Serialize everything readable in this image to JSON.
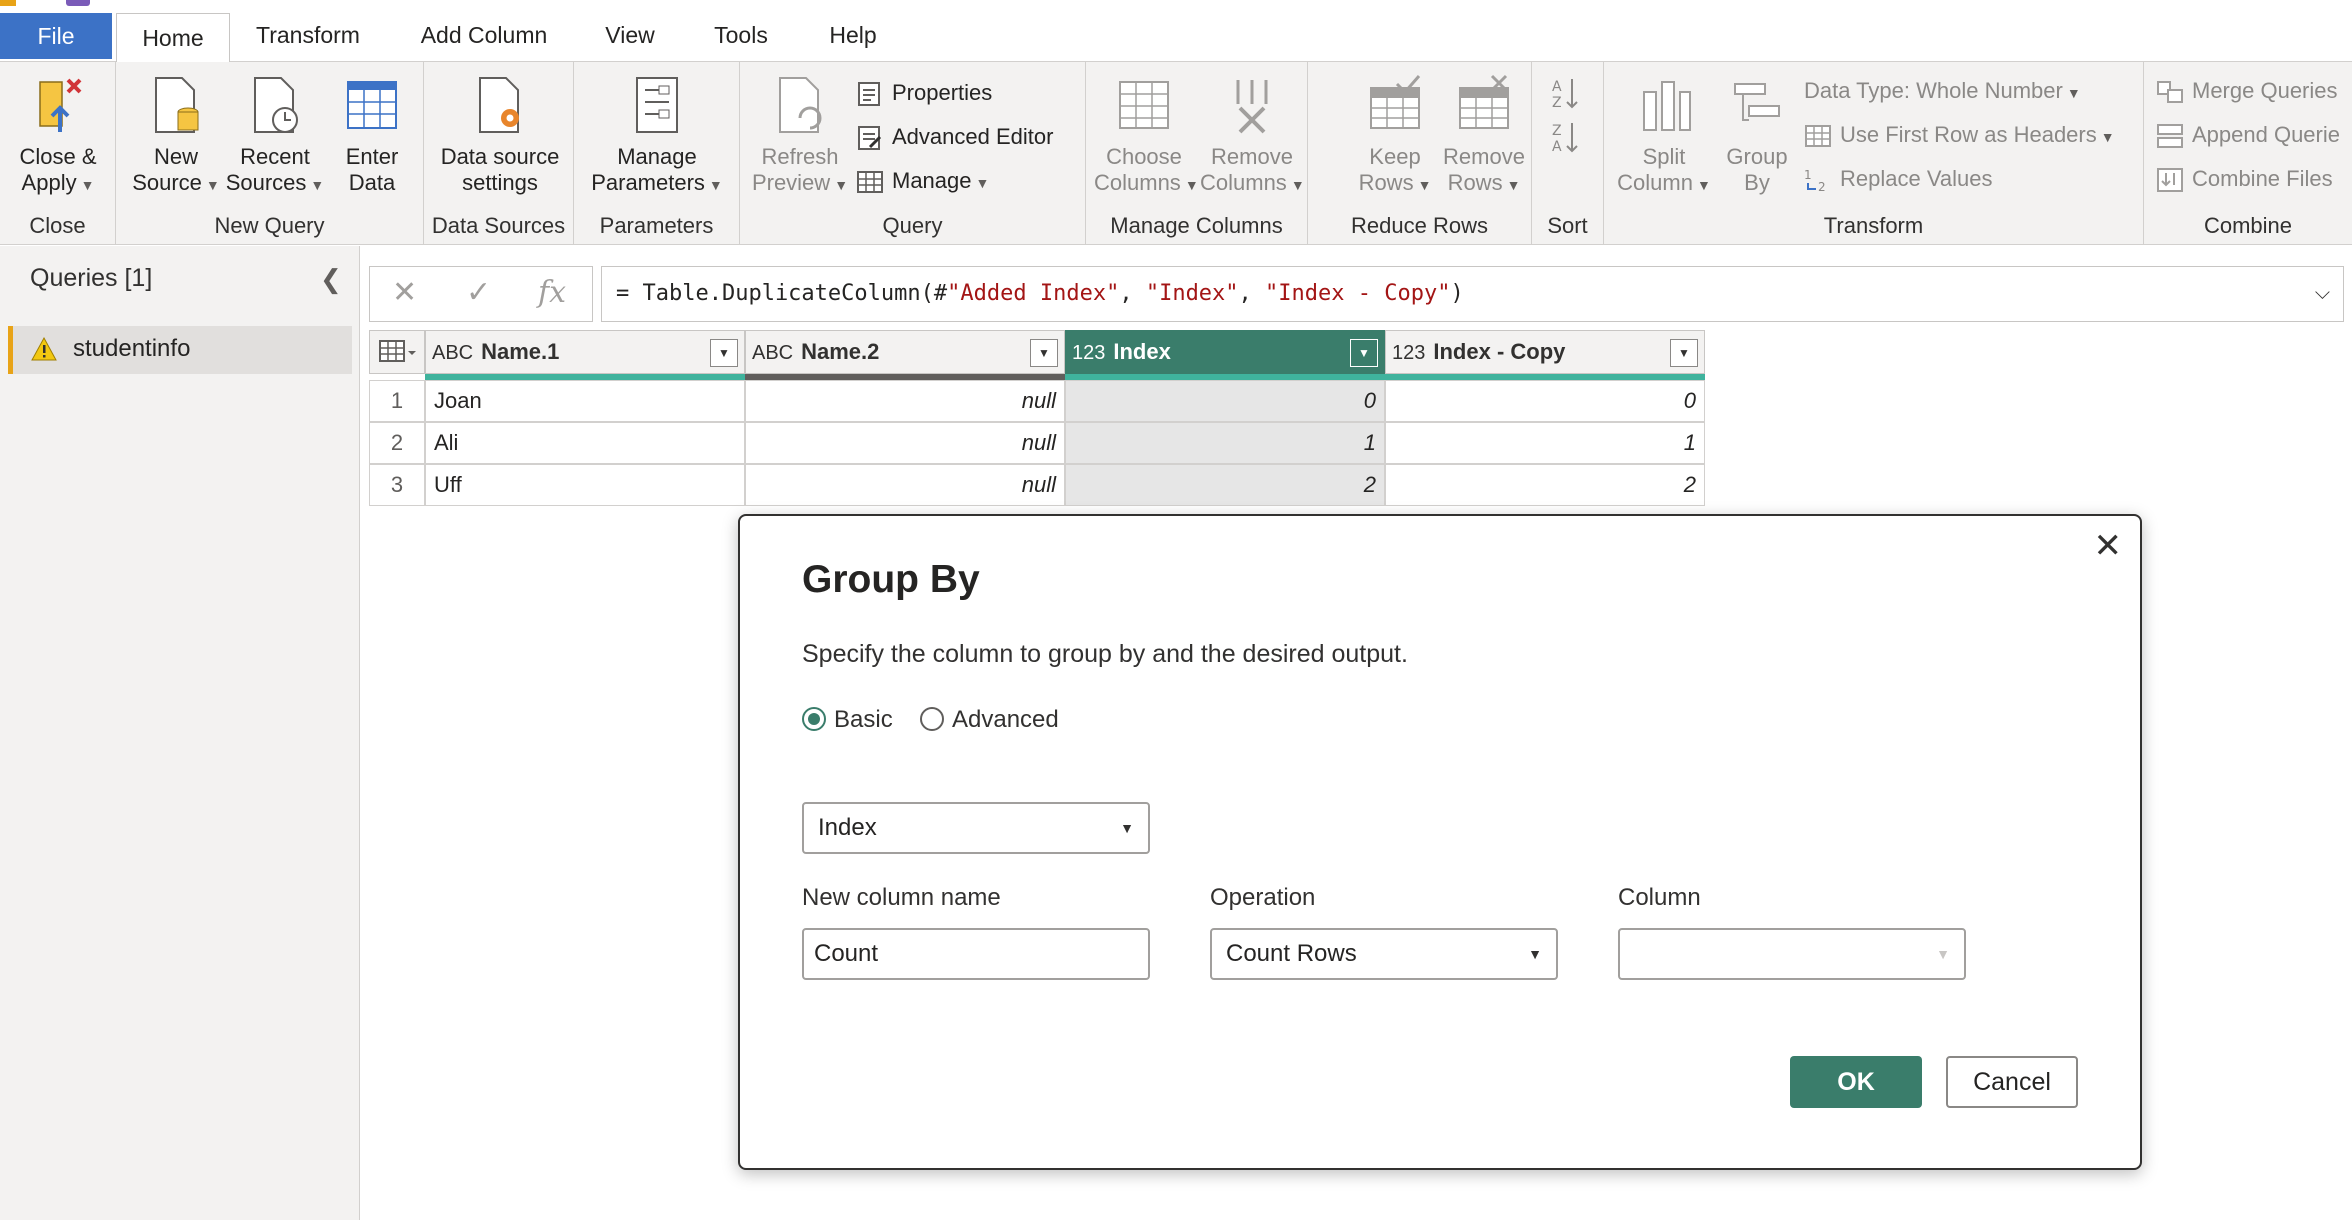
{
  "tabs": [
    {
      "label": "File"
    },
    {
      "label": "Home"
    },
    {
      "label": "Transform"
    },
    {
      "label": "Add Column"
    },
    {
      "label": "View"
    },
    {
      "label": "Tools"
    },
    {
      "label": "Help"
    }
  ],
  "ribbon": {
    "close": {
      "group": "Close",
      "close_apply_1": "Close &",
      "close_apply_2": "Apply"
    },
    "new_query": {
      "group": "New Query",
      "new_source_1": "New",
      "new_source_2": "Source",
      "recent_1": "Recent",
      "recent_2": "Sources",
      "enter_1": "Enter",
      "enter_2": "Data"
    },
    "data_sources": {
      "group": "Data Sources",
      "btn_1": "Data source",
      "btn_2": "settings"
    },
    "parameters": {
      "group": "Parameters",
      "btn_1": "Manage",
      "btn_2": "Parameters"
    },
    "query": {
      "group": "Query",
      "refresh_1": "Refresh",
      "refresh_2": "Preview",
      "properties": "Properties",
      "advanced_editor": "Advanced Editor",
      "manage": "Manage"
    },
    "manage_columns": {
      "group": "Manage Columns",
      "choose_1": "Choose",
      "choose_2": "Columns",
      "remove_1": "Remove",
      "remove_2": "Columns"
    },
    "reduce_rows": {
      "group": "Reduce Rows",
      "keep_1": "Keep",
      "keep_2": "Rows",
      "remove_1": "Remove",
      "remove_2": "Rows"
    },
    "sort": {
      "group": "Sort"
    },
    "transform": {
      "group": "Transform",
      "split_1": "Split",
      "split_2": "Column",
      "group_1": "Group",
      "group_2": "By",
      "data_type": "Data Type: Whole Number",
      "first_row": "Use First Row as Headers",
      "replace": "Replace Values"
    },
    "combine": {
      "group": "Combine",
      "merge": "Merge Queries",
      "append": "Append Querie",
      "combine_files": "Combine Files"
    }
  },
  "queries": {
    "header": "Queries [1]",
    "items": [
      {
        "label": "studentinfo"
      }
    ]
  },
  "formula": {
    "prefix": "= Table.DuplicateColumn(#",
    "s1": "\"Added Index\"",
    "s2": "\"Index\"",
    "s3": "\"Index - Copy\"",
    "sep": ", ",
    "suffix": ")"
  },
  "table": {
    "columns": [
      {
        "type": "ABC",
        "name": "Name.1"
      },
      {
        "type": "ABC",
        "name": "Name.2"
      },
      {
        "type": "123",
        "name": "Index"
      },
      {
        "type": "123",
        "name": "Index - Copy"
      }
    ],
    "rows": [
      {
        "num": "1",
        "c1": "Joan",
        "c2": "null",
        "c3": "0",
        "c4": "0"
      },
      {
        "num": "2",
        "c1": "Ali",
        "c2": "null",
        "c3": "1",
        "c4": "1"
      },
      {
        "num": "3",
        "c1": "Uff",
        "c2": "null",
        "c3": "2",
        "c4": "2"
      }
    ]
  },
  "dialog": {
    "title": "Group By",
    "description": "Specify the column to group by and the desired output.",
    "radio_basic": "Basic",
    "radio_advanced": "Advanced",
    "group_column": "Index",
    "new_column_label": "New column name",
    "new_column_value": "Count",
    "operation_label": "Operation",
    "operation_value": "Count Rows",
    "column_label": "Column",
    "column_value": "",
    "ok": "OK",
    "cancel": "Cancel"
  },
  "colors": {
    "accent": "#3a7d6b",
    "file_tab": "#3c72c6",
    "warning": "#e8a317"
  }
}
